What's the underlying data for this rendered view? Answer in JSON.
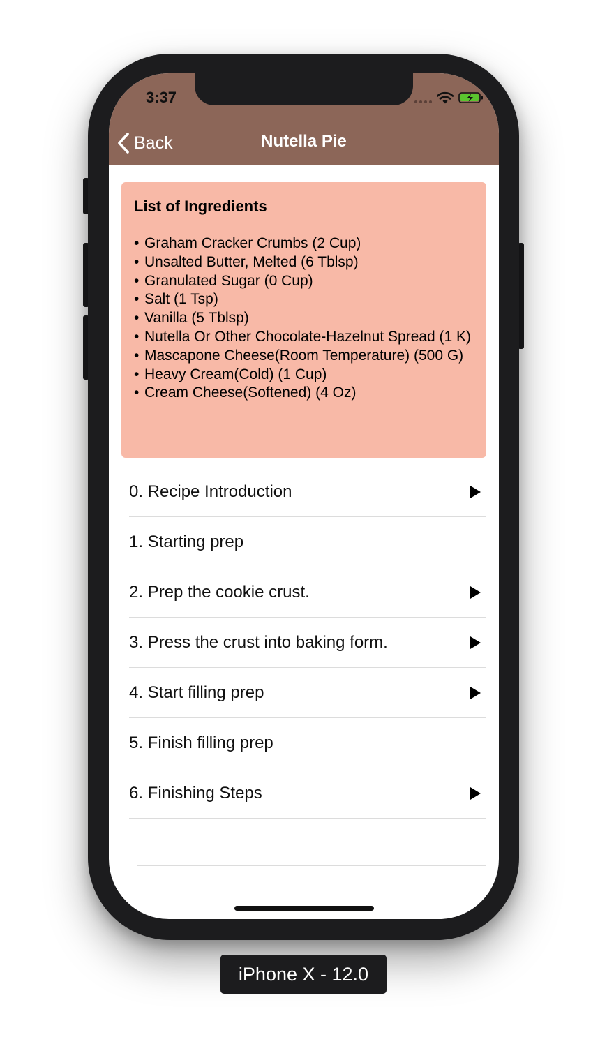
{
  "status_bar": {
    "time": "3:37"
  },
  "nav": {
    "back_label": "Back",
    "title": "Nutella Pie"
  },
  "ingredients": {
    "title": "List of Ingredients",
    "items": [
      "Graham Cracker Crumbs (2 Cup)",
      "Unsalted Butter, Melted (6 Tblsp)",
      "Granulated Sugar (0 Cup)",
      "Salt (1 Tsp)",
      "Vanilla (5 Tblsp)",
      "Nutella Or Other Chocolate-Hazelnut Spread (1 K)",
      "Mascapone Cheese(Room Temperature) (500 G)",
      "Heavy Cream(Cold) (1 Cup)",
      "Cream Cheese(Softened) (4 Oz)"
    ]
  },
  "steps": [
    {
      "label": "0. Recipe Introduction",
      "has_video": true
    },
    {
      "label": "1. Starting prep",
      "has_video": false
    },
    {
      "label": "2. Prep the cookie crust.",
      "has_video": true
    },
    {
      "label": "3. Press the crust into baking form.",
      "has_video": true
    },
    {
      "label": "4. Start filling prep",
      "has_video": true
    },
    {
      "label": "5. Finish filling prep",
      "has_video": false
    },
    {
      "label": "6. Finishing Steps",
      "has_video": true
    }
  ],
  "device_label": "iPhone X - 12.0",
  "colors": {
    "nav_background": "#8c6658",
    "ingredients_background": "#f8b9a7",
    "battery_fill": "#5ac52e"
  }
}
